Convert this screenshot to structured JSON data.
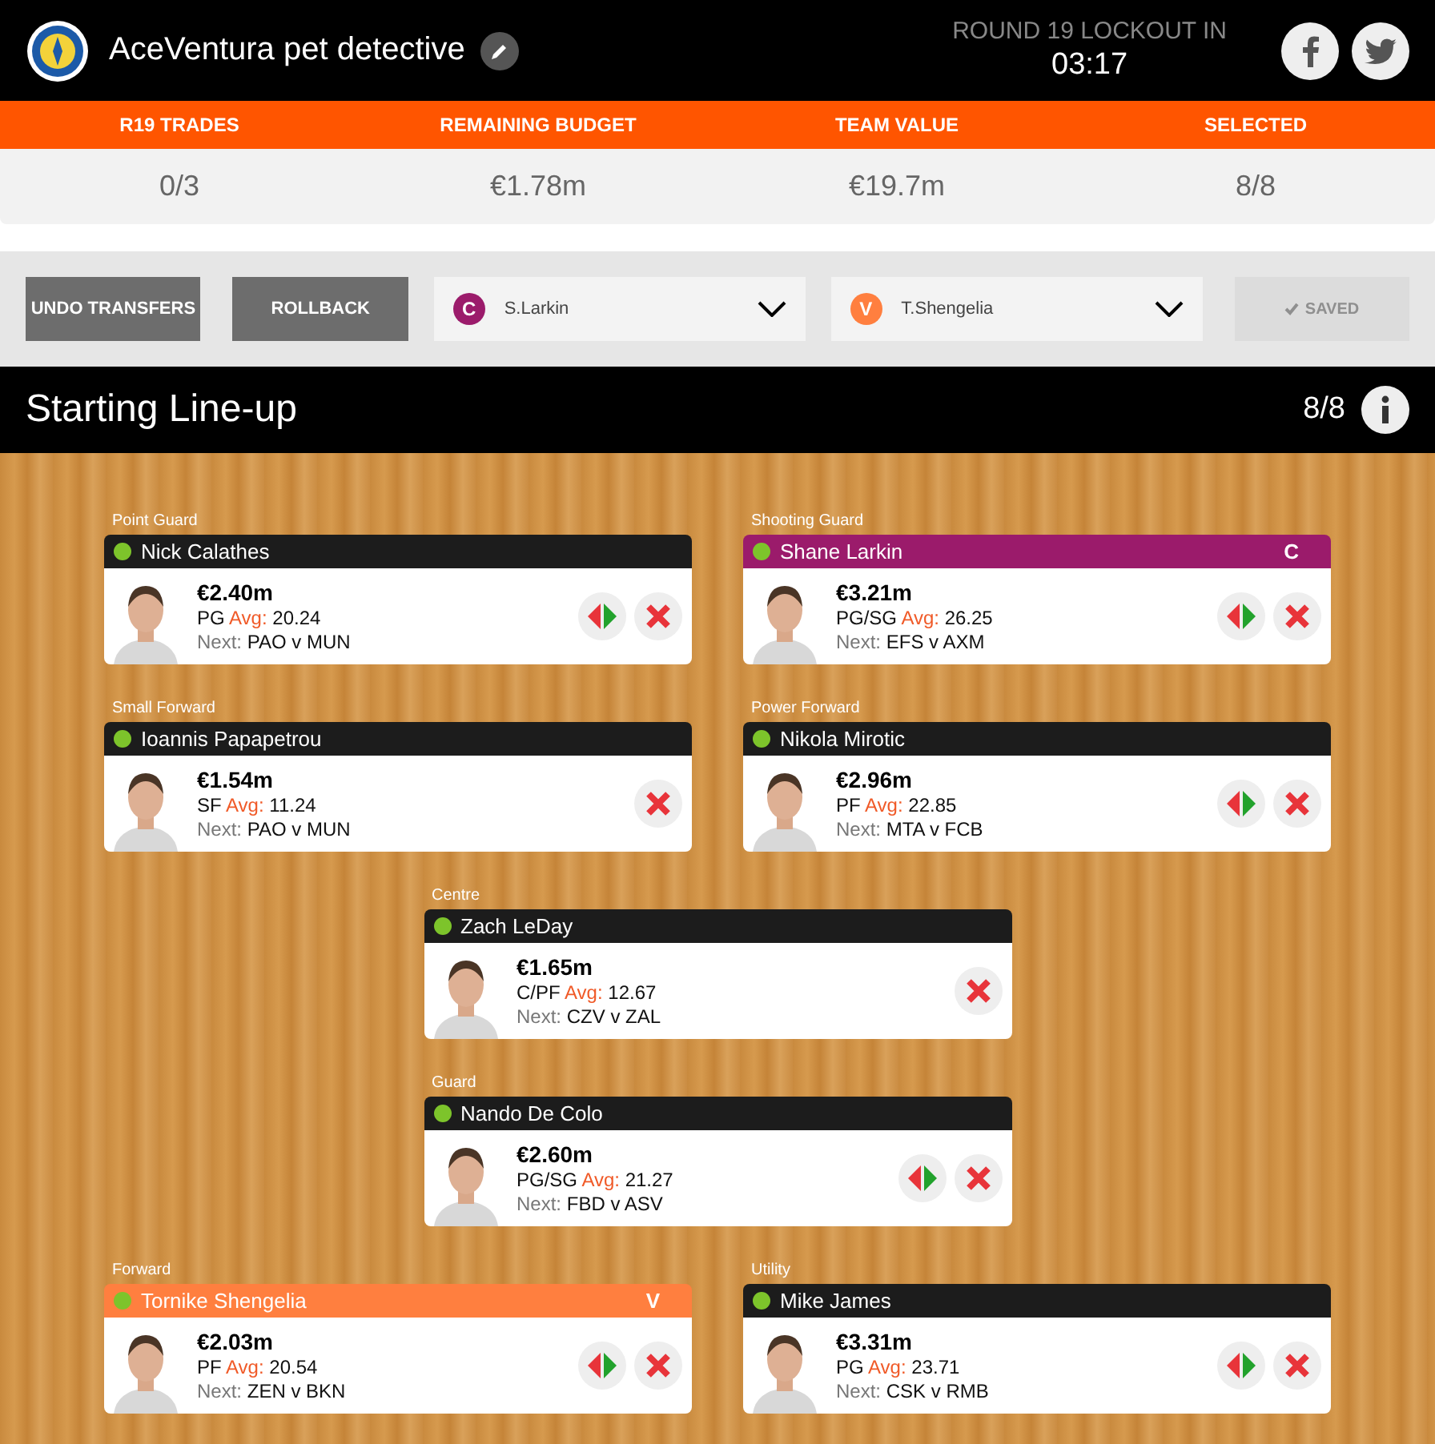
{
  "header": {
    "team_name": "AceVentura pet detective",
    "lockout_label": "ROUND 19 LOCKOUT IN",
    "countdown": "03:17"
  },
  "stats": [
    {
      "label": "R19 TRADES",
      "value": "0/3"
    },
    {
      "label": "REMAINING BUDGET",
      "value": "€1.78m"
    },
    {
      "label": "TEAM VALUE",
      "value": "€19.7m"
    },
    {
      "label": "SELECTED",
      "value": "8/8"
    }
  ],
  "controls": {
    "undo": "UNDO TRANSFERS",
    "rollback": "ROLLBACK",
    "pickers": [
      {
        "kind": "captain",
        "letter": "C",
        "player": "S.Larkin"
      },
      {
        "kind": "vice",
        "letter": "V",
        "player": "T.Shengelia"
      }
    ],
    "saved": {
      "label": "SAVED",
      "disabled": true
    }
  },
  "lineup": {
    "title": "Starting Line-up",
    "count": "8/8",
    "rows": [
      [
        {
          "position": "Point Guard",
          "name": "Nick Calathes",
          "kind": "regular",
          "price": "€2.40m",
          "role": "PG",
          "avg_label": "Avg:",
          "avg": "20.24",
          "next_label": "Next:",
          "fixture": "PAO v MUN",
          "can_swap": true
        },
        {
          "position": "Shooting Guard",
          "name": "Shane Larkin",
          "kind": "captain",
          "badge_letter": "C",
          "price": "€3.21m",
          "role": "PG/SG",
          "avg_label": "Avg:",
          "avg": "26.25",
          "next_label": "Next:",
          "fixture": "EFS v AXM",
          "can_swap": true
        }
      ],
      [
        {
          "position": "Small Forward",
          "name": "Ioannis Papapetrou",
          "kind": "regular",
          "price": "€1.54m",
          "role": "SF",
          "avg_label": "Avg:",
          "avg": "11.24",
          "next_label": "Next:",
          "fixture": "PAO v MUN",
          "can_swap": false
        },
        {
          "position": "Power Forward",
          "name": "Nikola Mirotic",
          "kind": "regular",
          "price": "€2.96m",
          "role": "PF",
          "avg_label": "Avg:",
          "avg": "22.85",
          "next_label": "Next:",
          "fixture": "MTA v FCB",
          "can_swap": true
        }
      ],
      [
        {
          "position": "Centre",
          "name": "Zach LeDay",
          "kind": "regular",
          "price": "€1.65m",
          "role": "C/PF",
          "avg_label": "Avg:",
          "avg": "12.67",
          "next_label": "Next:",
          "fixture": "CZV v ZAL",
          "can_swap": false
        }
      ],
      [
        {
          "position": "Guard",
          "name": "Nando De Colo",
          "kind": "regular",
          "price": "€2.60m",
          "role": "PG/SG",
          "avg_label": "Avg:",
          "avg": "21.27",
          "next_label": "Next:",
          "fixture": "FBD v ASV",
          "can_swap": true
        }
      ],
      [
        {
          "position": "Forward",
          "name": "Tornike Shengelia",
          "kind": "vice",
          "badge_letter": "V",
          "price": "€2.03m",
          "role": "PF",
          "avg_label": "Avg:",
          "avg": "20.54",
          "next_label": "Next:",
          "fixture": "ZEN v BKN",
          "can_swap": true
        },
        {
          "position": "Utility",
          "name": "Mike James",
          "kind": "regular",
          "price": "€3.31m",
          "role": "PG",
          "avg_label": "Avg:",
          "avg": "23.71",
          "next_label": "Next:",
          "fixture": "CSK v RMB",
          "can_swap": true
        }
      ]
    ]
  }
}
